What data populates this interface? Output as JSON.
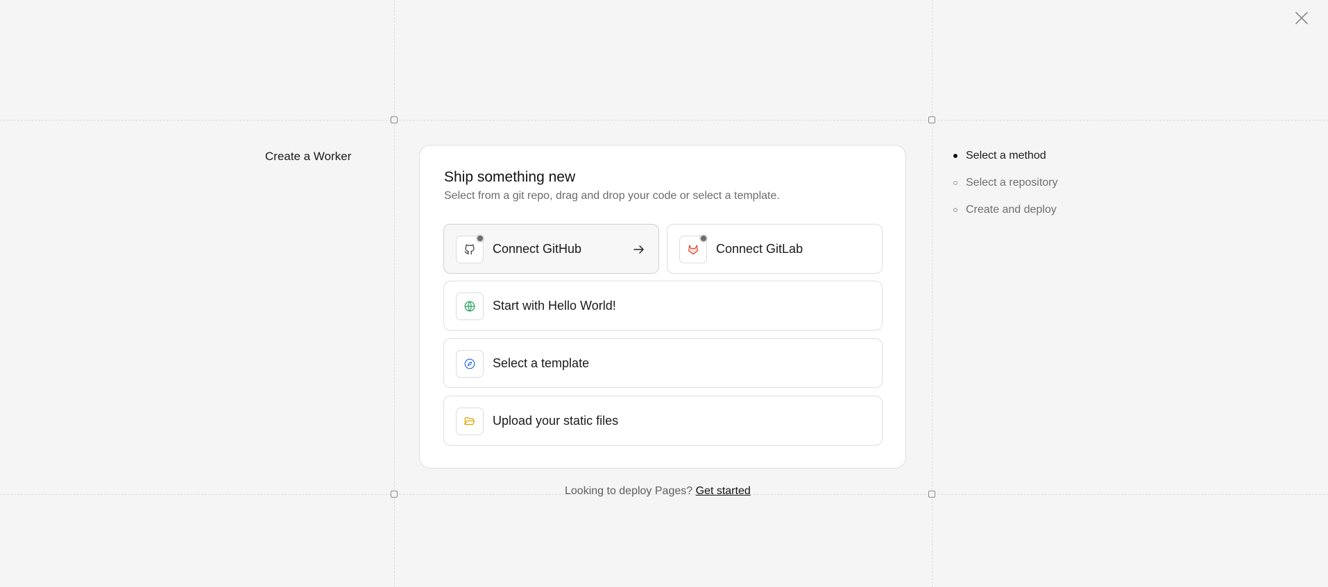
{
  "header": {
    "close_icon": "close-icon"
  },
  "page": {
    "title": "Create a Worker"
  },
  "card": {
    "title": "Ship something new",
    "subtitle": "Select from a git repo, drag and drop your code or select a template.",
    "options": [
      {
        "label": "Connect GitHub",
        "icon": "github-icon",
        "accent": "#333333"
      },
      {
        "label": "Connect GitLab",
        "icon": "gitlab-icon",
        "accent": "#e2432a"
      },
      {
        "label": "Start with Hello World!",
        "icon": "globe-icon",
        "accent": "#22a05a"
      },
      {
        "label": "Select a template",
        "icon": "compass-icon",
        "accent": "#2f6fd8"
      },
      {
        "label": "Upload your static files",
        "icon": "folder-open-icon",
        "accent": "#e0a400"
      }
    ]
  },
  "footer": {
    "text": "Looking to deploy Pages?",
    "link": "Get started"
  },
  "steps": [
    {
      "label": "Select a method",
      "state": "current"
    },
    {
      "label": "Select a repository",
      "state": "pending"
    },
    {
      "label": "Create and deploy",
      "state": "pending"
    }
  ]
}
